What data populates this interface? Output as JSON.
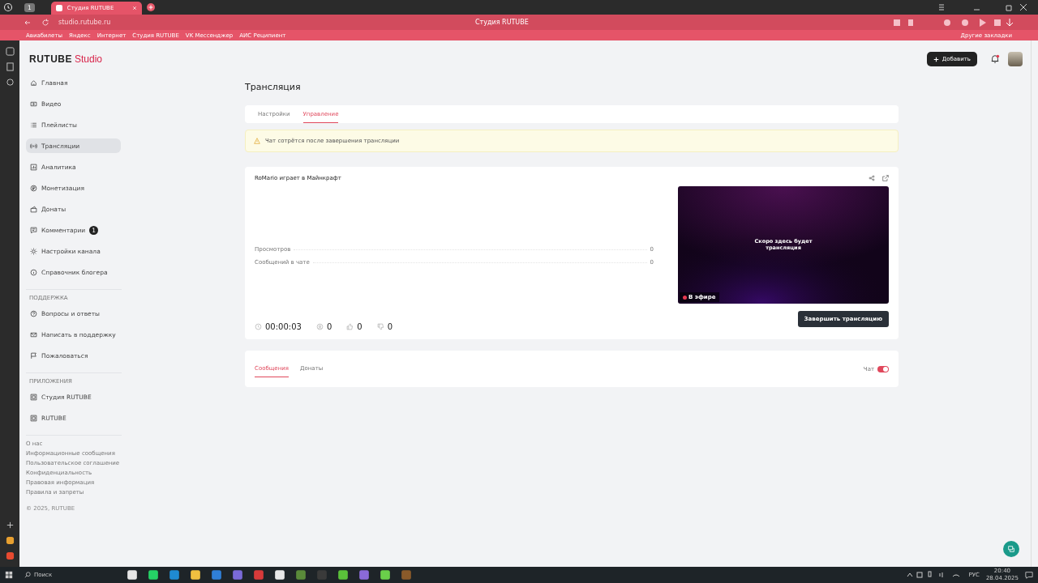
{
  "browser": {
    "tab_count": "1",
    "tab_title": "Студия RUTUBE",
    "url": "studio.rutube.ru",
    "page_title": "Студия RUTUBE",
    "bookmarks": [
      "Авиабилеты",
      "Яндекс",
      "Интернет",
      "Студия RUTUBE",
      "VK Мессенджер",
      "АИС Реципиент"
    ],
    "other_bookmarks": "Другие закладки"
  },
  "header": {
    "logo": "RUTUBE",
    "logo_suffix": "Studio",
    "add_button": "Добавить",
    "has_notification": true
  },
  "sidebar": {
    "items": [
      {
        "label": "Главная",
        "selected": false
      },
      {
        "label": "Видео",
        "selected": false
      },
      {
        "label": "Плейлисты",
        "selected": false
      },
      {
        "label": "Трансляции",
        "selected": true
      },
      {
        "label": "Аналитика",
        "selected": false
      },
      {
        "label": "Монетизация",
        "selected": false
      },
      {
        "label": "Донаты",
        "selected": false
      },
      {
        "label": "Комментарии",
        "selected": false,
        "badge": "1"
      },
      {
        "label": "Настройки канала",
        "selected": false
      },
      {
        "label": "Справочник блогера",
        "selected": false
      }
    ],
    "sections": [
      {
        "title": "ПОДДЕРЖКА",
        "items": [
          {
            "label": "Вопросы и ответы",
            "selected": false
          },
          {
            "label": "Написать в поддержку",
            "selected": false
          },
          {
            "label": "Пожаловаться",
            "selected": false
          }
        ]
      },
      {
        "title": "ПРИЛОЖЕНИЯ",
        "items": [
          {
            "label": "Студия RUTUBE",
            "selected": false
          },
          {
            "label": "RUTUBE",
            "selected": false
          }
        ]
      }
    ],
    "footer_links": [
      "О нас",
      "Информационные сообщения",
      "Пользовательское соглашение",
      "Конфиденциальность",
      "Правовая информация",
      "Правила и запреты"
    ],
    "copyright": "© 2025, RUTUBE"
  },
  "page": {
    "title": "Трансляция",
    "tabs": [
      {
        "label": "Настройки",
        "selected": false
      },
      {
        "label": "Управление",
        "selected": true
      }
    ],
    "warning": "Чат сотрётся после завершения трансляции",
    "stream": {
      "title": "RoMario играет в Майнкрафт",
      "stats": [
        {
          "label": "Просмотров",
          "value": "0"
        },
        {
          "label": "Сообщений в чате",
          "value": "0"
        }
      ],
      "preview_text": "Скоро здесь будет трансляция",
      "live_label": "В эфире",
      "duration": "00:00:03",
      "counters": [
        {
          "kind": "viewers",
          "value": "0"
        },
        {
          "kind": "likes",
          "value": "0"
        },
        {
          "kind": "dislikes",
          "value": "0"
        }
      ],
      "end_button": "Завершить трансляцию"
    },
    "chat": {
      "tabs": [
        {
          "label": "Сообщения",
          "selected": true
        },
        {
          "label": "Донаты",
          "selected": false
        }
      ],
      "toggle_label": "Чат",
      "toggle_on": true
    }
  },
  "taskbar": {
    "search": "Поиск",
    "language": "РУС",
    "time": "20:40",
    "date": "28.04.2025"
  }
}
